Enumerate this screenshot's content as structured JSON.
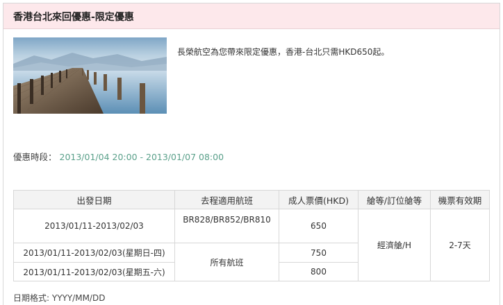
{
  "header": {
    "title": "香港台北來回優惠-限定優惠"
  },
  "promo": {
    "image_icon": "pier-landscape-photo",
    "intro": "長榮航空為您帶來限定優惠，香港-台北只需HKD650起。"
  },
  "period": {
    "label": "優惠時段：",
    "value": "2013/01/04 20:00 - 2013/01/07 08:00"
  },
  "table": {
    "headers": [
      "出發日期",
      "去程適用航班",
      "成人票價(HKD)",
      "艙等/訂位艙等",
      "機票有效期"
    ],
    "rows": [
      {
        "date": "2013/01/11-2013/02/03",
        "flights": "BR828/BR852/BR810",
        "price": "650"
      },
      {
        "date": "2013/01/11-2013/02/03(星期日-四)",
        "flights": "所有航班",
        "price": "750"
      },
      {
        "date": "2013/01/11-2013/02/03(星期五-六)",
        "flights": "所有航班",
        "price": "800"
      }
    ],
    "cabin": "經濟艙/H",
    "validity": "2-7天"
  },
  "footer": {
    "date_format_note": "日期格式: YYYY/MM/DD"
  },
  "colors": {
    "title_bg": "#fde8eb",
    "period_value": "#5aa08a",
    "header_bg": "#f3f3f3",
    "border": "#d7d7d7"
  }
}
